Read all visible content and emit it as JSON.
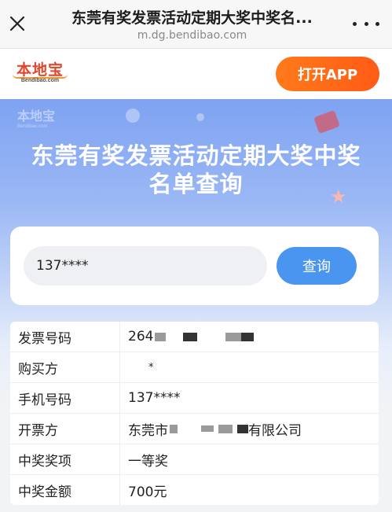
{
  "browser": {
    "title": "东莞有奖发票活动定期大奖中奖名...",
    "url": "m.dg.bendibao.com"
  },
  "logo": {
    "cn": "本地宝",
    "en": "Bendibao.com"
  },
  "header": {
    "open_app": "打开APP"
  },
  "hero": {
    "title_line1": "东莞有奖发票活动定期大奖中奖",
    "title_line2": "名单查询"
  },
  "search": {
    "value": "137****",
    "button": "查询"
  },
  "result": {
    "rows": [
      {
        "label": "发票号码",
        "value": "264"
      },
      {
        "label": "购买方",
        "value": "*"
      },
      {
        "label": "手机号码",
        "value": "137****"
      },
      {
        "label": "开票方",
        "value_prefix": "东莞市",
        "value_suffix": "有限公司"
      },
      {
        "label": "中奖奖项",
        "value": "一等奖"
      },
      {
        "label": "中奖金额",
        "value": "700元"
      }
    ]
  },
  "colors": {
    "accent_orange": "#ff6a17",
    "accent_blue": "#4a95f0",
    "hero_blue": "#7fa3f2"
  }
}
